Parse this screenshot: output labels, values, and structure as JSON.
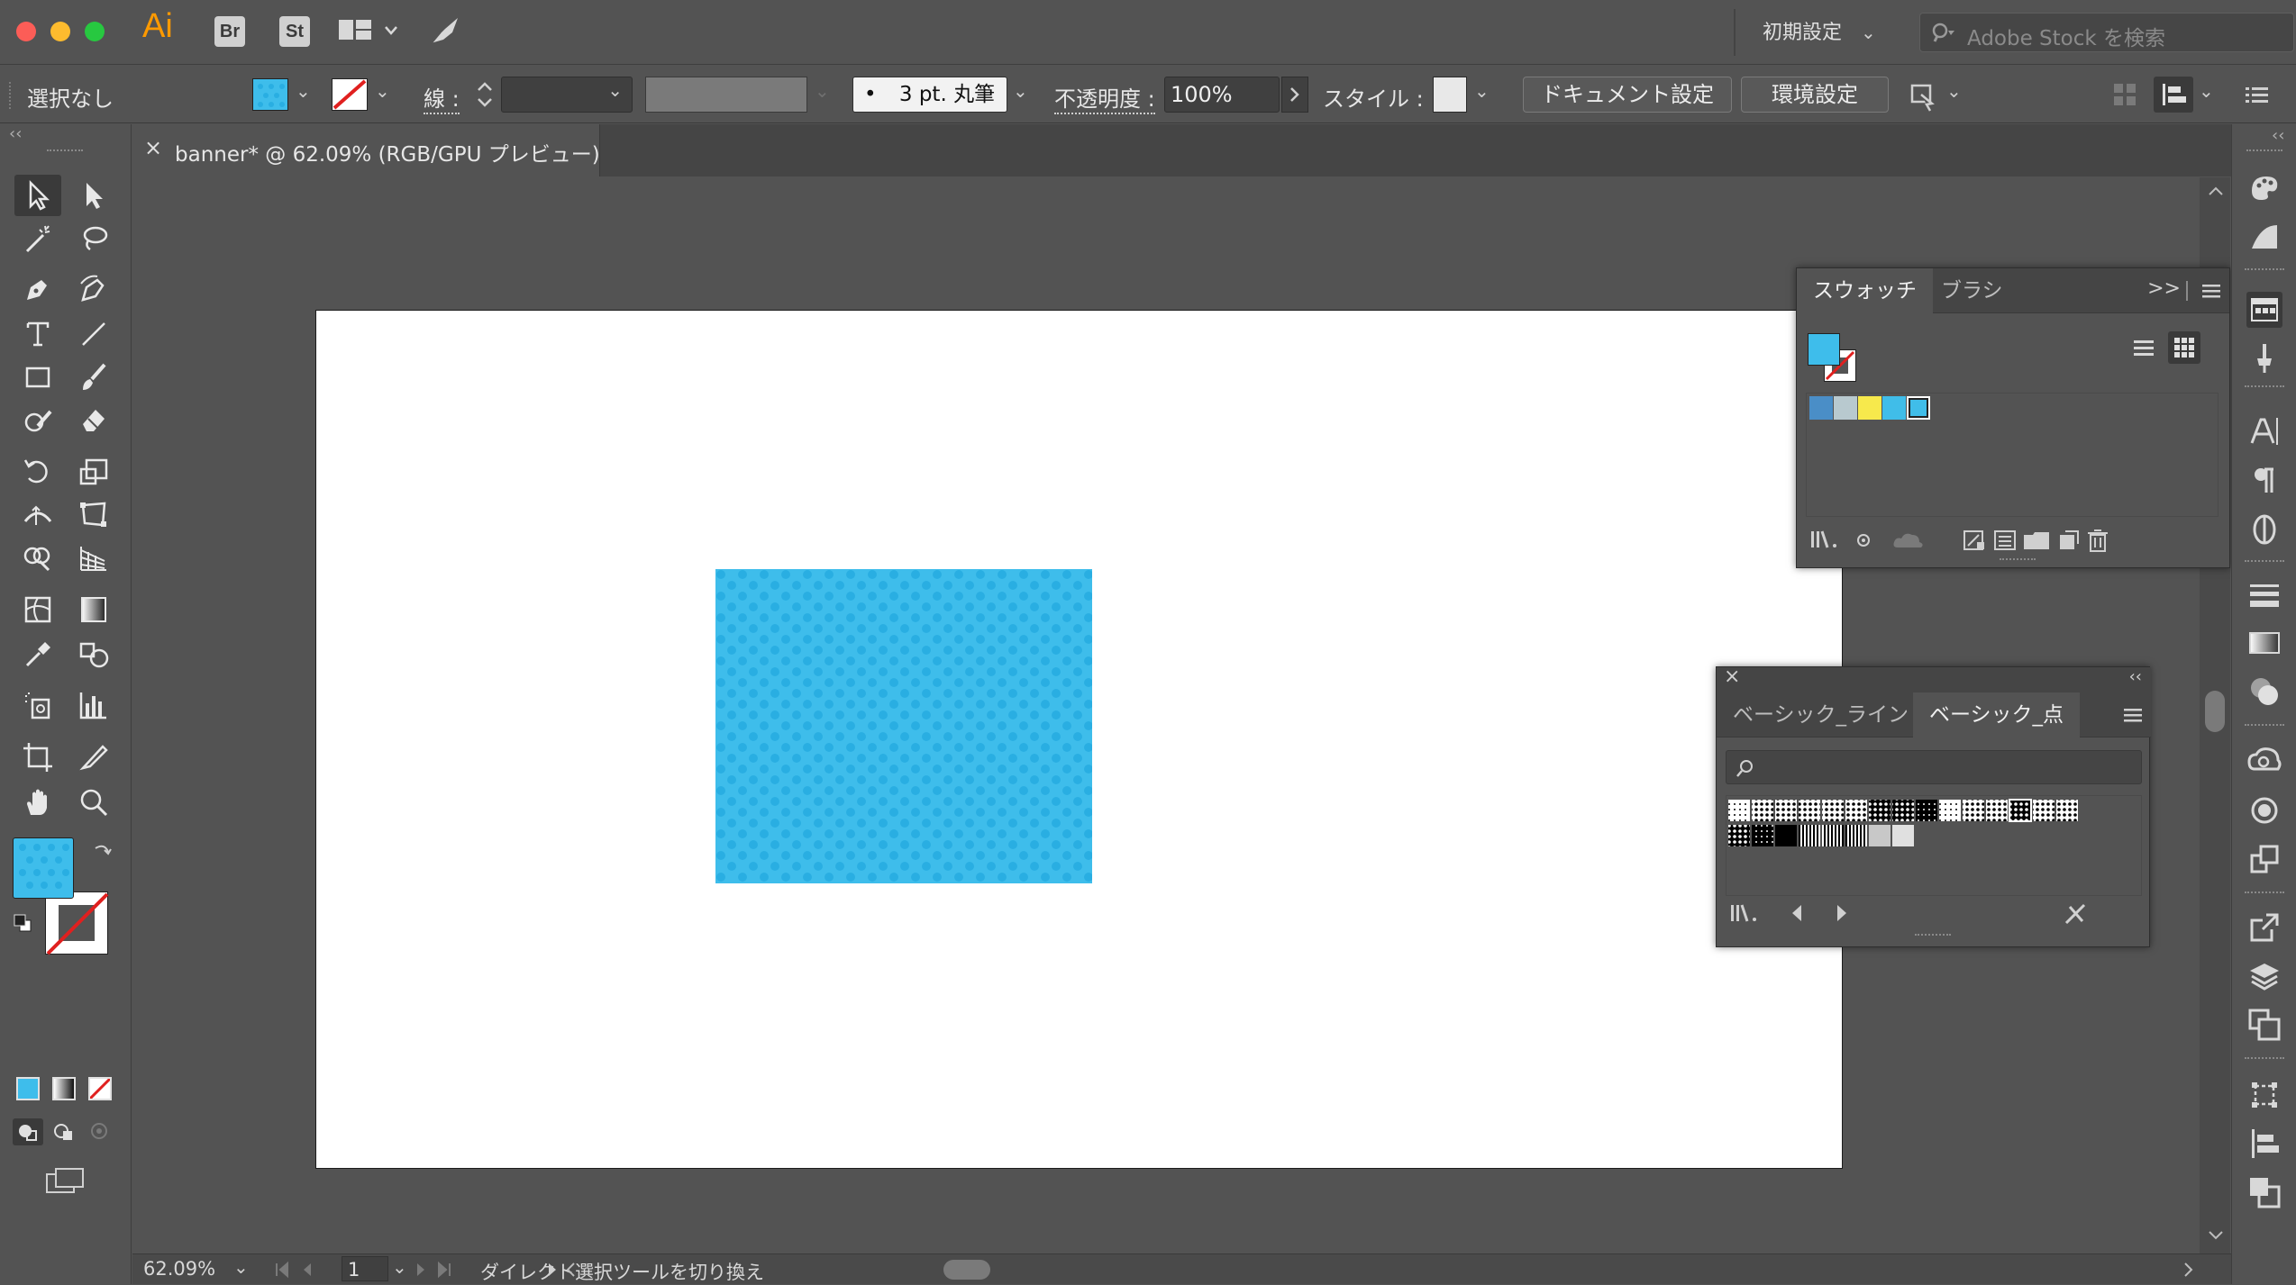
{
  "app": {
    "logo": "Ai",
    "bridge_label": "Br",
    "stock_label": "St",
    "workspace": "初期設定",
    "stock_search_placeholder": "Adobe Stock を検索"
  },
  "control_bar": {
    "selection_label": "選択なし",
    "stroke_label": "線 :",
    "brush_dot": "•",
    "brush_label": "3 pt. 丸筆",
    "opacity_label": "不透明度 :",
    "opacity_value": "100%",
    "style_label": "スタイル :",
    "document_setup": "ドキュメント設定",
    "preferences": "環境設定"
  },
  "document": {
    "close": "×",
    "tab_title": "banner* @ 62.09% (RGB/GPU プレビュー)"
  },
  "canvas": {
    "fill_color": "#3ebdeb",
    "dot_color": "#29aee2",
    "artboard_color": "#ffffff"
  },
  "swatches_panel": {
    "tabs": [
      "スウォッチ",
      "ブラシ"
    ],
    "expand": ">>",
    "swatches": [
      "#4a8ec7",
      "#b8c9cf",
      "#f7e94c",
      "#40bde9",
      "#40bde9"
    ]
  },
  "pattern_library_panel": {
    "close": "×",
    "collapse": "‹‹",
    "tabs": [
      "ベーシック_ライン",
      "ベーシック_点"
    ]
  },
  "status_bar": {
    "zoom": "62.09%",
    "page": "1",
    "hint": "ダイレクト選択ツールを切り換え"
  }
}
